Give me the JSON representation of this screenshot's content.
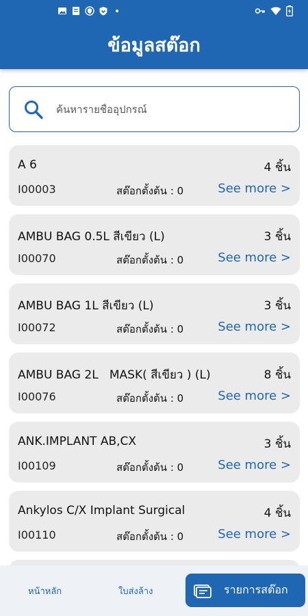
{
  "header": {
    "title": "ข้อมูลสต๊อก"
  },
  "search": {
    "placeholder": "ค้นหารายชื่ออุปกรณ์"
  },
  "items": [
    {
      "name": "A 6",
      "qty": "4 ชิ้น",
      "code": "I00003",
      "stock": "สต๊อกตั้งต้น : 0",
      "more": "See more >"
    },
    {
      "name": "AMBU BAG 0.5L สีเขียว (L)",
      "qty": "3 ชิ้น",
      "code": "I00070",
      "stock": "สต๊อกตั้งต้น : 0",
      "more": "See more >"
    },
    {
      "name": "AMBU BAG 1L สีเขียว (L)",
      "qty": "3 ชิ้น",
      "code": "I00072",
      "stock": "สต๊อกตั้งต้น : 0",
      "more": "See more >"
    },
    {
      "name": "AMBU BAG 2L   MASK( สีเขียว ) (L)",
      "qty": "8 ชิ้น",
      "code": "I00076",
      "stock": "สต๊อกตั้งต้น : 0",
      "more": "See more >"
    },
    {
      "name": "ANK.IMPLANT AB,CX",
      "qty": "3 ชิ้น",
      "code": "I00109",
      "stock": "สต๊อกตั้งต้น : 0",
      "more": "See more >"
    },
    {
      "name": "Ankylos C/X Implant Surgical",
      "qty": "4 ชิ้น",
      "code": "I00110",
      "stock": "สต๊อกตั้งต้น : 0",
      "more": "See more >"
    }
  ],
  "nav": {
    "home": "หน้าหลัก",
    "invoice": "ใบส่งล้าง",
    "stock_list": "รายการสต๊อก"
  }
}
